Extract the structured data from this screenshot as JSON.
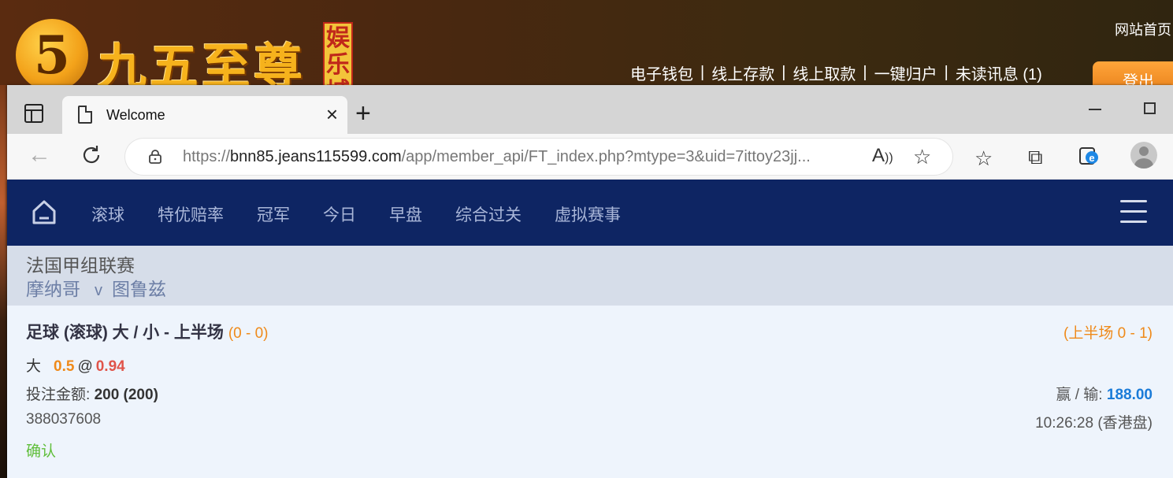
{
  "site": {
    "logo_number": "5",
    "logo_name": "九五至尊",
    "logo_badge": "娱乐城",
    "home_link": "网站首页",
    "links": [
      "电子钱包",
      "线上存款",
      "线上取款",
      "一键归户",
      "未读讯息 (1)"
    ],
    "logout": "登出"
  },
  "browser": {
    "tab_title": "Welcome",
    "url_prefix": "https://",
    "url_host": "bnn85.jeans115599.com",
    "url_path": "/app/member_api/FT_index.php?mtype=3&uid=7ittoy23jj..."
  },
  "nav": {
    "items": [
      "滚球",
      "特优赔率",
      "冠军",
      "今日",
      "早盘",
      "综合过关",
      "虚拟赛事"
    ]
  },
  "match": {
    "league": "法国甲组联赛",
    "home_team": "摩纳哥",
    "vs": "v",
    "away_team": "图鲁兹"
  },
  "bet": {
    "title": "足球 (滚球) 大 / 小 - 上半场",
    "score": "(0 - 0)",
    "half_score": "(上半场 0 - 1)",
    "pick": "大",
    "line": "0.5",
    "at": "@",
    "odds": "0.94",
    "stake_label": "投注金额:",
    "stake_value": "200 (200)",
    "winloss_label": "赢 / 输:",
    "winloss_value": "188.00",
    "ticket_id": "388037608",
    "time": "10:26:28 (香港盘)",
    "status": "确认"
  },
  "colors": {
    "navbar": "#0e2563",
    "orange": "#ef8a1a",
    "odds_red": "#e0544a",
    "amount_blue": "#1a7bd8",
    "confirm_green": "#5fbe3a"
  }
}
